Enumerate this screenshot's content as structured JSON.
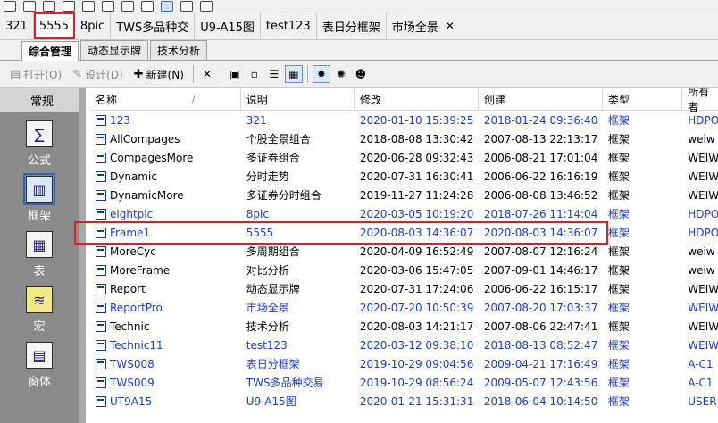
{
  "doc_tabs": [
    {
      "label": "321",
      "active": false
    },
    {
      "label": "5555",
      "active": true
    },
    {
      "label": "8pic",
      "active": false
    },
    {
      "label": "TWS多品种交",
      "active": false
    },
    {
      "label": "U9-A15图",
      "active": false
    },
    {
      "label": "test123",
      "active": false
    },
    {
      "label": "表日分框架",
      "active": false
    },
    {
      "label": "市场全景",
      "active": false
    }
  ],
  "close_glyph": "✕",
  "view_tabs": [
    "综合管理",
    "动态显示牌",
    "技术分析"
  ],
  "toolbar": {
    "open": "打开(O)",
    "design": "设计(D)",
    "new": "新建(N)"
  },
  "left_panel": {
    "title": "常规",
    "items": [
      {
        "label": "公式",
        "icon": "formula-icon"
      },
      {
        "label": "框架",
        "icon": "frame-icon",
        "selected": true
      },
      {
        "label": "表",
        "icon": "table-icon"
      },
      {
        "label": "宏",
        "icon": "macro-icon"
      },
      {
        "label": "窗体",
        "icon": "form-icon"
      }
    ]
  },
  "columns": [
    "名称",
    "说明",
    "修改",
    "创建",
    "类型",
    "所有者"
  ],
  "rows": [
    {
      "name": "123",
      "desc": "321",
      "mod": "2020-01-10 15:39:25",
      "cre": "2018-01-24 09:36:40",
      "type": "框架",
      "owner": "HDPO",
      "blue": true
    },
    {
      "name": "AllCompages",
      "desc": "个股全景组合",
      "mod": "2018-08-08 13:30:42",
      "cre": "2007-08-13 22:13:17",
      "type": "框架",
      "owner": "weiw",
      "blue": false
    },
    {
      "name": "CompagesMore",
      "desc": "多证券组合",
      "mod": "2020-06-28 09:32:43",
      "cre": "2006-08-21 17:01:04",
      "type": "框架",
      "owner": "WEIW",
      "blue": false
    },
    {
      "name": "Dynamic",
      "desc": "分时走势",
      "mod": "2020-07-31 16:30:41",
      "cre": "2006-06-22 16:16:19",
      "type": "框架",
      "owner": "WEIW",
      "blue": false
    },
    {
      "name": "DynamicMore",
      "desc": "多证券分时组合",
      "mod": "2019-11-27 11:24:28",
      "cre": "2006-08-08 13:46:52",
      "type": "框架",
      "owner": "WEIW",
      "blue": false
    },
    {
      "name": "eightpic",
      "desc": "8pic",
      "mod": "2020-03-05 10:19:20",
      "cre": "2018-07-26 11:14:04",
      "type": "框架",
      "owner": "HDPO",
      "blue": true
    },
    {
      "name": "Frame1",
      "desc": "5555",
      "mod": "2020-08-03 14:36:07",
      "cre": "2020-08-03 14:36:07",
      "type": "框架",
      "owner": "HDPO",
      "blue": true
    },
    {
      "name": "MoreCyc",
      "desc": "多周期组合",
      "mod": "2020-04-09 16:52:49",
      "cre": "2007-08-07 12:16:24",
      "type": "框架",
      "owner": "weiw",
      "blue": false
    },
    {
      "name": "MoreFrame",
      "desc": "对比分析",
      "mod": "2020-03-06 15:47:05",
      "cre": "2007-09-01 14:46:17",
      "type": "框架",
      "owner": "weiw",
      "blue": false
    },
    {
      "name": "Report",
      "desc": "动态显示牌",
      "mod": "2020-07-31 17:24:06",
      "cre": "2006-06-22 16:15:17",
      "type": "框架",
      "owner": "WEIW",
      "blue": false
    },
    {
      "name": "ReportPro",
      "desc": "市场全景",
      "mod": "2020-07-20 10:50:39",
      "cre": "2007-08-20 17:03:37",
      "type": "框架",
      "owner": "WEIW",
      "blue": true
    },
    {
      "name": "Technic",
      "desc": "技术分析",
      "mod": "2020-08-03 14:21:17",
      "cre": "2007-08-06 22:47:41",
      "type": "框架",
      "owner": "WEIW",
      "blue": false
    },
    {
      "name": "Technic11",
      "desc": "test123",
      "mod": "2020-03-12 09:38:10",
      "cre": "2018-08-13 08:52:47",
      "type": "框架",
      "owner": "WEIW",
      "blue": true
    },
    {
      "name": "TWS008",
      "desc": "表日分框架",
      "mod": "2019-10-29 09:04:56",
      "cre": "2009-04-21 17:16:49",
      "type": "框架",
      "owner": "A-C1",
      "blue": true
    },
    {
      "name": "TWS009",
      "desc": "TWS多品种交易",
      "mod": "2019-10-29 08:56:24",
      "cre": "2009-05-07 12:43:56",
      "type": "框架",
      "owner": "A-C1",
      "blue": true
    },
    {
      "name": "UT9A15",
      "desc": "U9-A15图",
      "mod": "2020-01-21 15:31:31",
      "cre": "2018-06-04 10:14:50",
      "type": "框架",
      "owner": "USER",
      "blue": true
    }
  ]
}
